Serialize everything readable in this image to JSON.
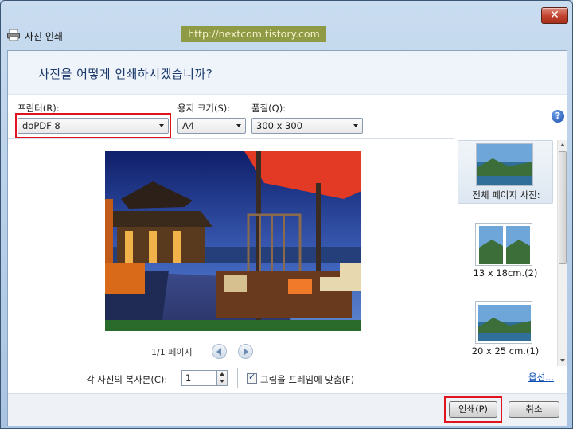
{
  "window": {
    "title": "사진 인쇄",
    "watermark": "http://nextcom.tistory.com",
    "close_label": "✕"
  },
  "heading": "사진을 어떻게 인쇄하시겠습니까?",
  "printer": {
    "label": "프린터(R):",
    "value": "doPDF 8"
  },
  "paper_size": {
    "label": "용지 크기(S):",
    "value": "A4"
  },
  "quality": {
    "label": "품질(Q):",
    "value": "300 x 300"
  },
  "help_icon": "?",
  "preview": {
    "page_label": "1/1 페이지"
  },
  "layouts": [
    {
      "label": "전체 페이지 사진:",
      "selected": true
    },
    {
      "label": "13 x 18cm.(2)",
      "selected": false
    },
    {
      "label": "20 x 25 cm.(1)",
      "selected": false
    }
  ],
  "copies": {
    "label": "각 사진의 복사본(C):",
    "value": "1"
  },
  "fit_to_frame": {
    "label": "그림을 프레임에 맞춤(F)",
    "checked": true,
    "check_glyph": "✓"
  },
  "options_link": "옵션...",
  "buttons": {
    "print": "인쇄(P)",
    "cancel": "취소"
  },
  "colors": {
    "highlight": "#e0141e",
    "heading": "#1c3a6b",
    "link": "#0b4fb5"
  }
}
